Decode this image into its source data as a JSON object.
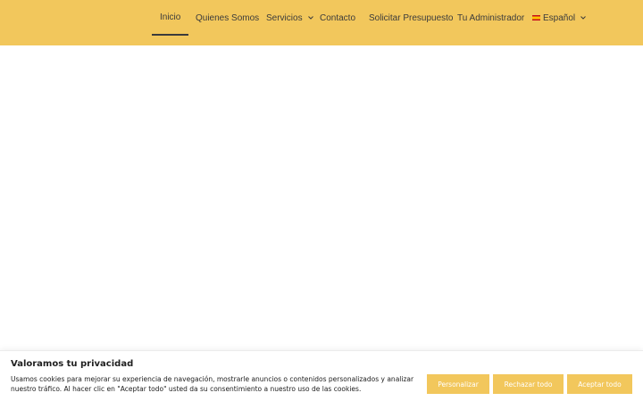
{
  "nav": {
    "items": [
      {
        "label": "Inicio"
      },
      {
        "label": "Quienes Somos"
      },
      {
        "label": "Servicios"
      },
      {
        "label": "Contacto"
      },
      {
        "label": "Solicitar Presupuesto"
      },
      {
        "label": "Tu Administrador"
      },
      {
        "label": "Español"
      }
    ]
  },
  "cookie": {
    "title": "Valoramos tu privacidad",
    "text": "Usamos cookies para mejorar su experiencia de navegación, mostrarle anuncios o contenidos personalizados y analizar nuestro tráfico. Al hacer clic en \"Aceptar todo\" usted da su consentimiento a nuestro uso de las cookies.",
    "buttons": {
      "customize": "Personalizar",
      "reject": "Rechazar todo",
      "accept": "Aceptar todo"
    }
  },
  "colors": {
    "header_bg": "#f2c75c",
    "button_bg": "#f2c75c",
    "text": "#3b3b3b"
  }
}
